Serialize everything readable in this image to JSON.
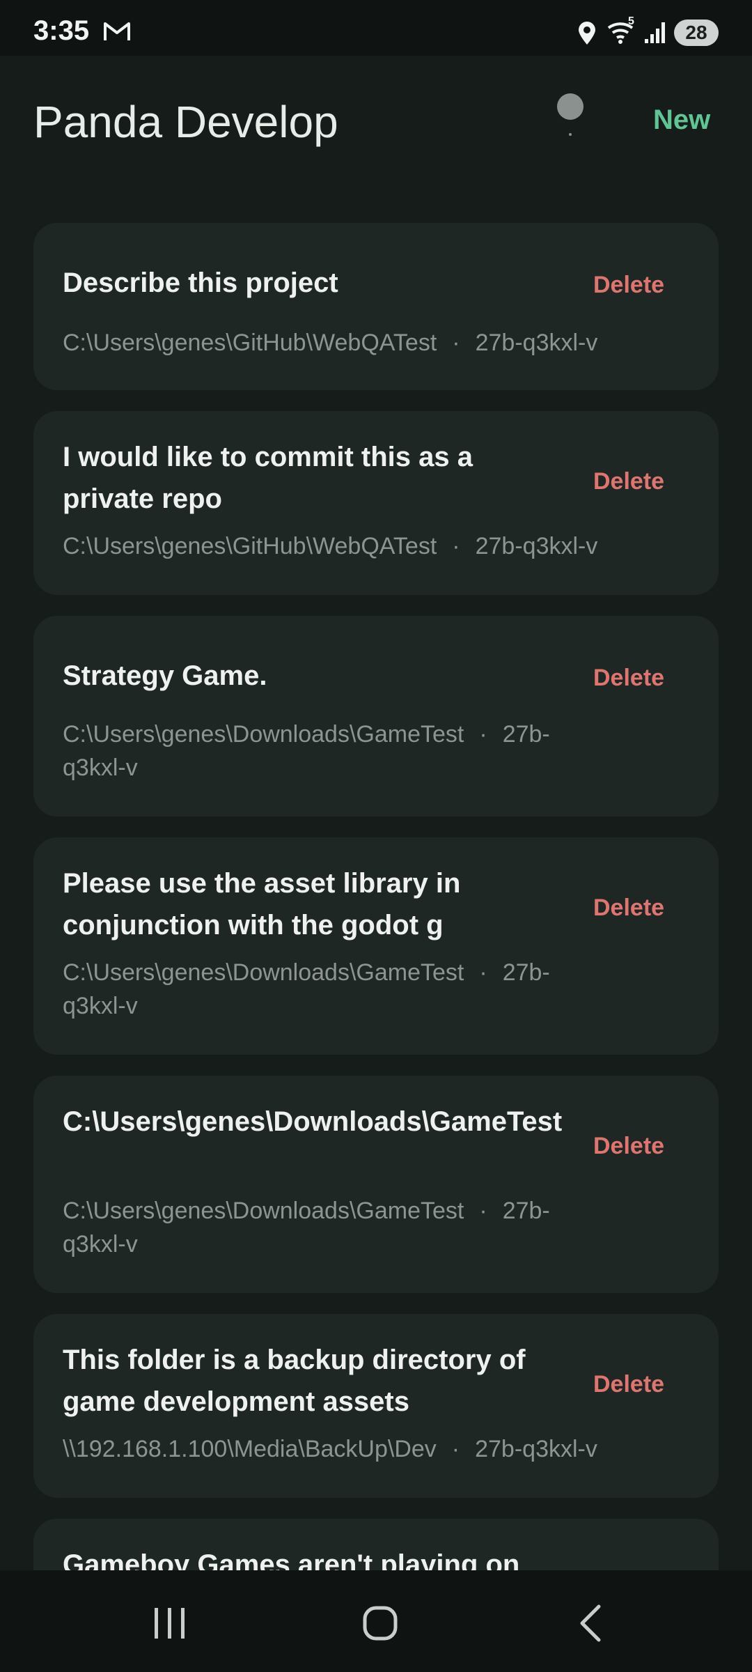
{
  "status_bar": {
    "time": "3:35",
    "wifi_label": "5",
    "battery": "28",
    "icons": [
      "gmail-icon",
      "location-icon",
      "wifi-icon",
      "signal-icon",
      "battery-icon"
    ]
  },
  "header": {
    "title": "Panda Develop",
    "new_label": "New",
    "accent_color": "#5fc594"
  },
  "sessions": [
    {
      "title": "Describe this project",
      "path": "C:\\Users\\genes\\GitHub\\WebQATest",
      "separator": "·",
      "model": "27b-q3kxl-v",
      "delete_label": "Delete"
    },
    {
      "title": "I would like to commit this as a private repo",
      "path": "C:\\Users\\genes\\GitHub\\WebQATest",
      "separator": "·",
      "model": "27b-q3kxl-v",
      "delete_label": "Delete"
    },
    {
      "title": "Strategy Game.",
      "path": "C:\\Users\\genes\\Downloads\\GameTest",
      "separator": "·",
      "model": "27b-q3kxl-v",
      "delete_label": "Delete"
    },
    {
      "title": "Please use the asset library in conjunction with the godot g",
      "path": "C:\\Users\\genes\\Downloads\\GameTest",
      "separator": "·",
      "model": "27b-q3kxl-v",
      "delete_label": "Delete"
    },
    {
      "title": "C:\\Users\\genes\\Downloads\\GameTest",
      "path": "C:\\Users\\genes\\Downloads\\GameTest",
      "separator": "·",
      "model": "27b-q3kxl-v",
      "delete_label": "Delete"
    },
    {
      "title": "This folder is a backup directory of game development assets",
      "path": "\\\\192.168.1.100\\Media\\BackUp\\Dev",
      "separator": "·",
      "model": "27b-q3kxl-v",
      "delete_label": "Delete"
    },
    {
      "title": "Gameboy Games aren't playing on the"
    }
  ],
  "nav_bar": {
    "buttons": [
      "recents-icon",
      "home-icon",
      "back-icon"
    ]
  },
  "colors": {
    "background": "#161c1a",
    "card": "#1f2725",
    "delete": "#df7570",
    "meta_text": "#8e9591"
  }
}
